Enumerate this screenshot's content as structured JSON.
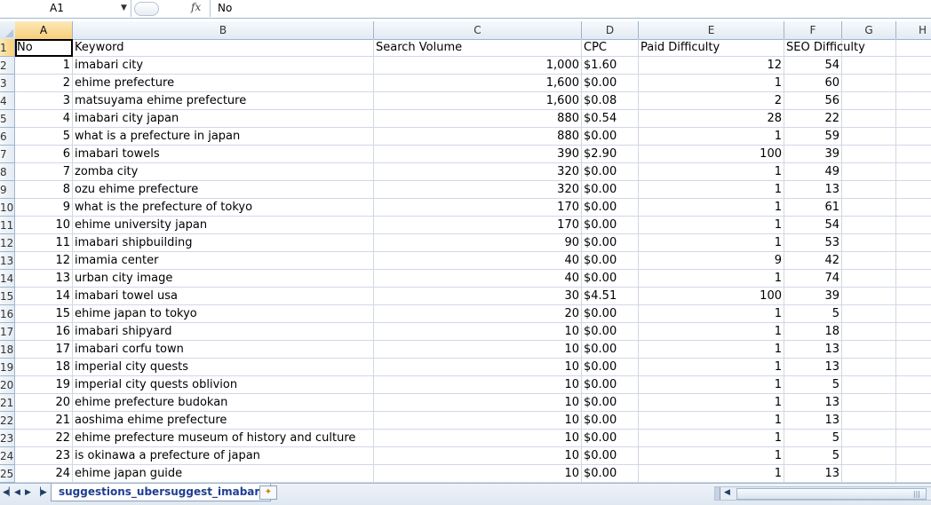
{
  "formula_bar": {
    "name_box": "A1",
    "fx_label": "fx",
    "content": "No"
  },
  "columns": [
    "A",
    "B",
    "C",
    "D",
    "E",
    "F",
    "G",
    "H"
  ],
  "selected_column": "A",
  "header_row": [
    "No",
    "Keyword",
    "Search Volume",
    "CPC",
    "Paid Difficulty",
    "SEO Difficulty"
  ],
  "rows": [
    [
      "1",
      "imabari city",
      "1,000",
      "$1.60",
      "12",
      "54"
    ],
    [
      "2",
      "ehime prefecture",
      "1,600",
      "$0.00",
      "1",
      "60"
    ],
    [
      "3",
      "matsuyama ehime prefecture",
      "1,600",
      "$0.08",
      "2",
      "56"
    ],
    [
      "4",
      "imabari city japan",
      "880",
      "$0.54",
      "28",
      "22"
    ],
    [
      "5",
      "what is a prefecture in japan",
      "880",
      "$0.00",
      "1",
      "59"
    ],
    [
      "6",
      "imabari towels",
      "390",
      "$2.90",
      "100",
      "39"
    ],
    [
      "7",
      "zomba city",
      "320",
      "$0.00",
      "1",
      "49"
    ],
    [
      "8",
      "ozu ehime prefecture",
      "320",
      "$0.00",
      "1",
      "13"
    ],
    [
      "9",
      "what is the prefecture of tokyo",
      "170",
      "$0.00",
      "1",
      "61"
    ],
    [
      "10",
      "ehime university japan",
      "170",
      "$0.00",
      "1",
      "54"
    ],
    [
      "11",
      "imabari shipbuilding",
      "90",
      "$0.00",
      "1",
      "53"
    ],
    [
      "12",
      "imamia center",
      "40",
      "$0.00",
      "9",
      "42"
    ],
    [
      "13",
      "urban city image",
      "40",
      "$0.00",
      "1",
      "74"
    ],
    [
      "14",
      "imabari towel usa",
      "30",
      "$4.51",
      "100",
      "39"
    ],
    [
      "15",
      "ehime japan to tokyo",
      "20",
      "$0.00",
      "1",
      "5"
    ],
    [
      "16",
      "imabari shipyard",
      "10",
      "$0.00",
      "1",
      "18"
    ],
    [
      "17",
      "imabari corfu town",
      "10",
      "$0.00",
      "1",
      "13"
    ],
    [
      "18",
      "imperial city quests",
      "10",
      "$0.00",
      "1",
      "13"
    ],
    [
      "19",
      "imperial city quests oblivion",
      "10",
      "$0.00",
      "1",
      "5"
    ],
    [
      "20",
      "ehime prefecture budokan",
      "10",
      "$0.00",
      "1",
      "13"
    ],
    [
      "21",
      "aoshima ehime prefecture",
      "10",
      "$0.00",
      "1",
      "13"
    ],
    [
      "22",
      "ehime prefecture museum of history and culture",
      "10",
      "$0.00",
      "1",
      "5"
    ],
    [
      "23",
      "is okinawa a prefecture of japan",
      "10",
      "$0.00",
      "1",
      "5"
    ],
    [
      "24",
      "ehime japan guide",
      "10",
      "$0.00",
      "1",
      "13"
    ]
  ],
  "sheet_tabs": [
    "suggestions_ubersuggest_imabari"
  ],
  "nav_icons": [
    "first-sheet-icon",
    "prev-sheet-icon",
    "next-sheet-icon",
    "last-sheet-icon"
  ],
  "colors": {
    "header_bg": "#e3eaf3",
    "selected_header": "#f8cf79",
    "gridline": "#d0d7e5",
    "tab_text": "#1f3e90"
  }
}
